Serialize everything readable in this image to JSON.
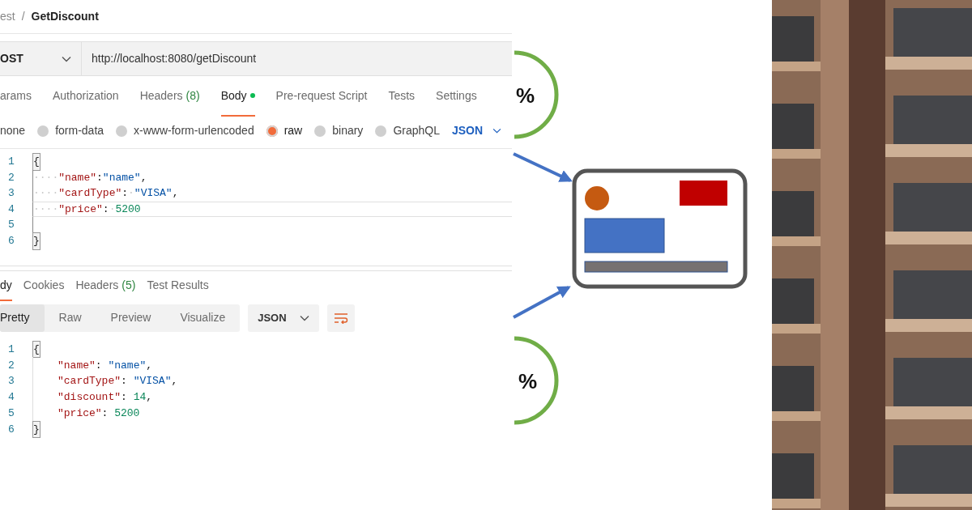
{
  "breadcrumb": {
    "parent": "est",
    "separator": "/",
    "current": "GetDiscount"
  },
  "request": {
    "method": "OST",
    "url": "http://localhost:8080/getDiscount"
  },
  "request_tabs": [
    {
      "label": "arams",
      "selected": false,
      "has_content": false
    },
    {
      "label": "Authorization",
      "selected": false,
      "has_content": false
    },
    {
      "label": "Headers",
      "count": "(8)",
      "selected": false,
      "has_content": false
    },
    {
      "label": "Body",
      "selected": true,
      "has_content": true
    },
    {
      "label": "Pre-request Script",
      "selected": false,
      "has_content": false
    },
    {
      "label": "Tests",
      "selected": false,
      "has_content": false
    },
    {
      "label": "Settings",
      "selected": false,
      "has_content": false
    }
  ],
  "body_types": [
    {
      "kind": "label",
      "label": "none",
      "selected": false
    },
    {
      "kind": "radio",
      "label": "form-data",
      "selected": false
    },
    {
      "kind": "radio",
      "label": "x-www-form-urlencoded",
      "selected": false
    },
    {
      "kind": "radio",
      "label": "raw",
      "selected": true
    },
    {
      "kind": "radio",
      "label": "binary",
      "selected": false
    },
    {
      "kind": "radio",
      "label": "GraphQL",
      "selected": false
    }
  ],
  "body_format": "JSON",
  "request_body": [
    {
      "number": "1",
      "active": false,
      "tokens": [
        {
          "kind": "bracket",
          "text": "{"
        }
      ]
    },
    {
      "number": "2",
      "active": false,
      "tokens": [
        {
          "kind": "ws",
          "text": "····"
        },
        {
          "kind": "key",
          "text": "\"name\""
        },
        {
          "kind": "punct",
          "text": ":"
        },
        {
          "kind": "string",
          "text": "\"name\""
        },
        {
          "kind": "punct",
          "text": ","
        }
      ]
    },
    {
      "number": "3",
      "active": false,
      "tokens": [
        {
          "kind": "ws",
          "text": "····"
        },
        {
          "kind": "key",
          "text": "\"cardType\""
        },
        {
          "kind": "punct",
          "text": ":"
        },
        {
          "kind": "ws",
          "text": "·"
        },
        {
          "kind": "string",
          "text": "\"VISA\""
        },
        {
          "kind": "punct",
          "text": ","
        }
      ]
    },
    {
      "number": "4",
      "active": true,
      "tokens": [
        {
          "kind": "ws",
          "text": "····"
        },
        {
          "kind": "key",
          "text": "\"price\""
        },
        {
          "kind": "punct",
          "text": ":"
        },
        {
          "kind": "ws",
          "text": "·"
        },
        {
          "kind": "number",
          "text": "5200"
        }
      ]
    },
    {
      "number": "5",
      "active": false
    },
    {
      "number": "6",
      "active": false,
      "tokens": [
        {
          "kind": "bracket",
          "text": "}"
        }
      ]
    }
  ],
  "response_tabs": [
    {
      "label": "dy",
      "selected": true
    },
    {
      "label": "Cookies",
      "selected": false
    },
    {
      "label": "Headers",
      "count": "(5)",
      "selected": false
    },
    {
      "label": "Test Results",
      "selected": false
    }
  ],
  "view_modes": [
    {
      "label": "Pretty",
      "selected": true
    },
    {
      "label": "Raw",
      "selected": false
    },
    {
      "label": "Preview",
      "selected": false
    },
    {
      "label": "Visualize",
      "selected": false
    }
  ],
  "response_format": "JSON",
  "response_body": [
    {
      "number": "1",
      "indent": false,
      "tokens": [
        {
          "kind": "bracket",
          "text": "{"
        }
      ]
    },
    {
      "number": "2",
      "indent": true,
      "tokens": [
        {
          "kind": "key",
          "text": "\"name\""
        },
        {
          "kind": "punct",
          "text": ": "
        },
        {
          "kind": "string",
          "text": "\"name\""
        },
        {
          "kind": "punct",
          "text": ","
        }
      ]
    },
    {
      "number": "3",
      "indent": true,
      "tokens": [
        {
          "kind": "key",
          "text": "\"cardType\""
        },
        {
          "kind": "punct",
          "text": ": "
        },
        {
          "kind": "string",
          "text": "\"VISA\""
        },
        {
          "kind": "punct",
          "text": ","
        }
      ]
    },
    {
      "number": "4",
      "indent": true,
      "tokens": [
        {
          "kind": "key",
          "text": "\"discount\""
        },
        {
          "kind": "punct",
          "text": ": "
        },
        {
          "kind": "number",
          "text": "14"
        },
        {
          "kind": "punct",
          "text": ","
        }
      ]
    },
    {
      "number": "5",
      "indent": true,
      "tokens": [
        {
          "kind": "key",
          "text": "\"price\""
        },
        {
          "kind": "punct",
          "text": ": "
        },
        {
          "kind": "number",
          "text": "5200"
        }
      ]
    },
    {
      "number": "6",
      "indent": false,
      "tokens": [
        {
          "kind": "bracket",
          "text": "}"
        }
      ]
    }
  ],
  "diagram": {
    "badges": [
      "%",
      "%"
    ]
  }
}
